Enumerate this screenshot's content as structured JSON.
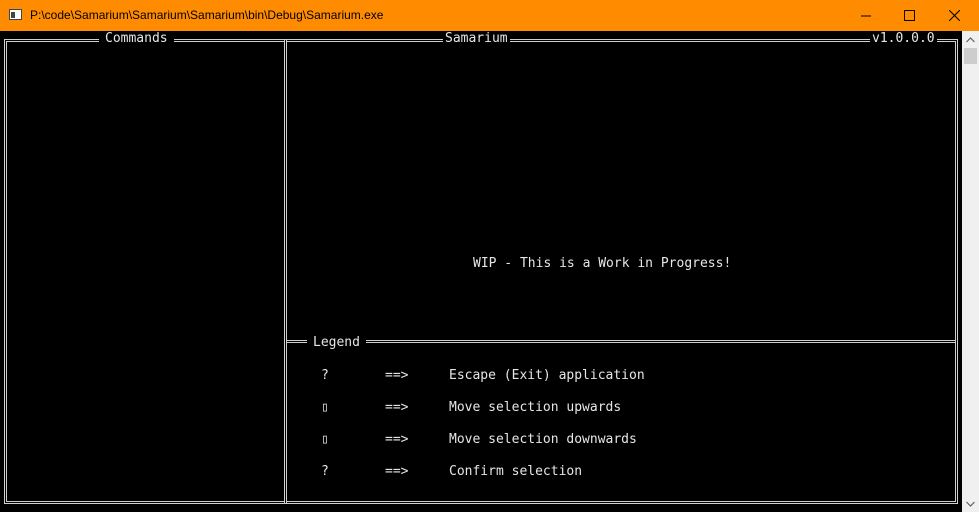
{
  "window": {
    "title": "P:\\code\\Samarium\\Samarium\\Samarium\\bin\\Debug\\Samarium.exe",
    "accent_color": "#ff8c00",
    "controls": {
      "minimize": "minimize-icon",
      "maximize": "maximize-icon",
      "close": "close-icon"
    }
  },
  "console": {
    "commands_panel": {
      "title": "Commands"
    },
    "main_panel": {
      "title": "Samarium",
      "version": "v1.0.0.0",
      "message": "WIP - This is a Work in Progress!"
    },
    "legend": {
      "title": "Legend",
      "items": [
        {
          "key": "?",
          "arrow": "==>",
          "description": "Escape (Exit) application"
        },
        {
          "key": "▯",
          "arrow": "==>",
          "description": "Move selection upwards"
        },
        {
          "key": "▯",
          "arrow": "==>",
          "description": "Move selection downwards"
        },
        {
          "key": "?",
          "arrow": "==>",
          "description": "Confirm selection"
        }
      ]
    }
  },
  "scrollbar": {
    "up": "scroll-up-arrow-icon",
    "down": "scroll-down-arrow-icon"
  }
}
